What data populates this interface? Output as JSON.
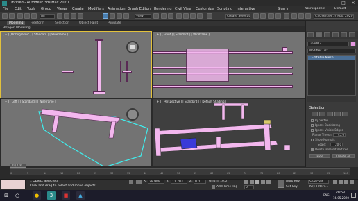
{
  "window": {
    "title": "Untitled - Autodesk 3ds Max 2020",
    "sign_in": "Sign In",
    "workspaces_label": "Workspaces:",
    "workspace_value": "Default",
    "path": "C:\\Users\\M...s Max 2020\\"
  },
  "menu": [
    "File",
    "Edit",
    "Tools",
    "Group",
    "Views",
    "Create",
    "Modifiers",
    "Animation",
    "Graph Editors",
    "Rendering",
    "Civil View",
    "Customize",
    "Scripting",
    "Interactive"
  ],
  "toolbar": {
    "filter": "All",
    "reference_coord": "View",
    "selection_set": "Create Selection Se"
  },
  "ribbon": {
    "tabs": [
      "Modeling",
      "Freeform",
      "Selection",
      "Object Paint",
      "Populate"
    ],
    "active_tab": "Modeling",
    "subbar": "Polygon Modeling"
  },
  "viewports": {
    "top": "[ + ] [Orthographic ] [ Standard ] [ Wireframe ]",
    "front": "[ + ] [ Front ] [ Standard ] [ Wireframe ]",
    "left": "[ + ] [ Left ] [ Standard ] [ Wireframe ]",
    "perspective": "[ + ] [ Perspective ] [ Standard ] [ Default Shading ]"
  },
  "command_panel": {
    "object_name": "Line003",
    "modifier_list": "Modifier List",
    "stack_item": "Editable Mesh",
    "selection_title": "Selection",
    "by_vertex": "By Vertex",
    "ignore_backfacing": "Ignore Backfacing",
    "ignore_visible_edges": "Ignore Visible Edges",
    "planar_thresh_label": "Planar Thresh:",
    "planar_thresh_value": "45.0",
    "show_normals": "Show Normals",
    "scale_label": "Scale:",
    "scale_value": "20.0",
    "delete_isolated": "Delete Isolated Vertices",
    "hide_label": "Hide",
    "unhide_label": "Unhide All"
  },
  "timeline": {
    "frame_display": "0 / 100",
    "ticks": [
      "0",
      "5",
      "10",
      "15",
      "20",
      "25",
      "30",
      "35",
      "40",
      "45",
      "50",
      "55",
      "60",
      "65",
      "70",
      "75",
      "80",
      "85",
      "90",
      "95",
      "100"
    ]
  },
  "status": {
    "selected": "1 Object Selected",
    "prompt": "Click and drag to select and move objects",
    "x_label": "X:",
    "x_value": "28.989",
    "y_label": "Y:",
    "y_value": "11.703",
    "z_label": "Z:",
    "z_value": "0.0",
    "grid": "Grid = 10.0",
    "add_time_tag": "Add Time Tag",
    "auto_key": "Auto Key",
    "set_key": "Set Key",
    "selected_dropdown": "Selected",
    "key_filters": "Key Filters...",
    "frame_value": "0"
  },
  "taskbar": {
    "time": "20:53",
    "date": "16.05.2020",
    "lang": "ENG"
  }
}
